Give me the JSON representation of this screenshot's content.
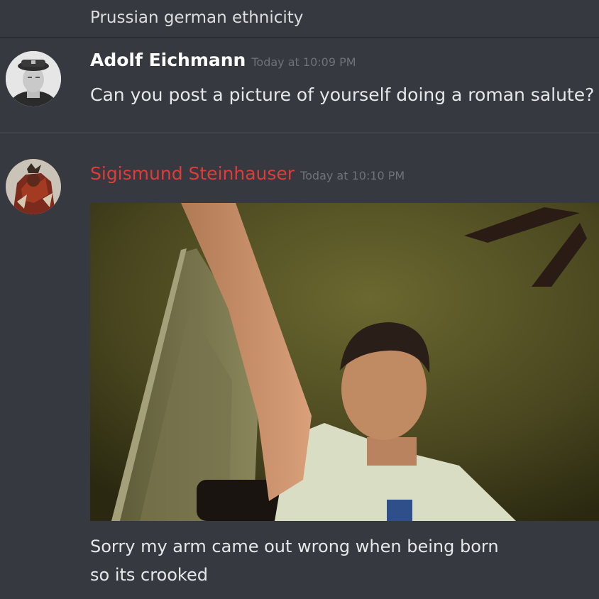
{
  "previous_message": {
    "text": "Prussian german ethnicity"
  },
  "messages": [
    {
      "username": "Adolf Eichmann",
      "timestamp": "Today at 10:09 PM",
      "text": "Can you post a picture of yourself doing a roman salute?"
    },
    {
      "username": "Sigismund Steinhauser",
      "username_color": "#e03b3b",
      "timestamp": "Today at 10:10 PM",
      "caption_line1": "Sorry my arm came out wrong when being born",
      "caption_line2": "so its crooked"
    }
  ],
  "theme": {
    "background": "#36393f",
    "divider": "#40434a"
  }
}
